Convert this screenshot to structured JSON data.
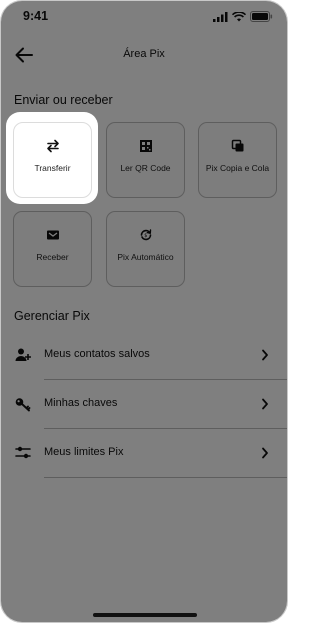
{
  "status_bar": {
    "time": "9:41"
  },
  "header": {
    "title": "Área Pix"
  },
  "send_receive": {
    "title": "Enviar ou receber",
    "tiles": [
      {
        "label": "Transferir",
        "icon": "transfer-arrows-icon"
      },
      {
        "label": "Ler QR Code",
        "icon": "qr-code-icon"
      },
      {
        "label": "Pix Copia e Cola",
        "icon": "copy-icon"
      },
      {
        "label": "Receber",
        "icon": "receive-envelope-icon"
      },
      {
        "label": "Pix Automático",
        "icon": "automatic-refresh-icon"
      }
    ]
  },
  "manage": {
    "title": "Gerenciar Pix",
    "rows": [
      {
        "label": "Meus contatos salvos",
        "icon": "add-contact-icon"
      },
      {
        "label": "Minhas chaves",
        "icon": "key-icon"
      },
      {
        "label": "Meus limites Pix",
        "icon": "sliders-icon"
      }
    ]
  },
  "colors": {
    "overlay": "#00000080",
    "text": "#111111",
    "tile_border": "#bdbdbd"
  }
}
